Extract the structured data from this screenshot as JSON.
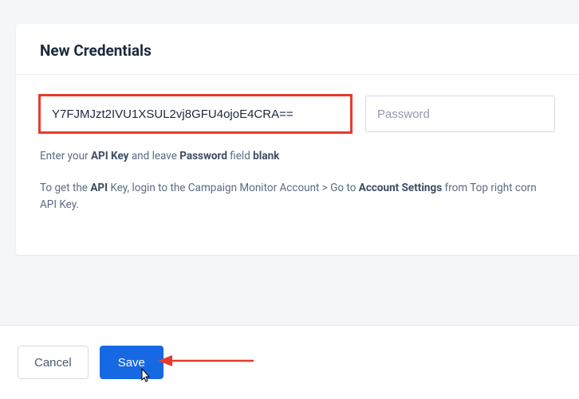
{
  "card": {
    "title": "New Credentials",
    "api_key_value": "Y7FJMJzt2IVU1XSUL2vj8GFU4ojoE4CRA==",
    "password_placeholder": "Password",
    "hint1_prefix": "Enter your ",
    "hint1_bold1": "API Key",
    "hint1_mid": " and leave ",
    "hint1_bold2": "Password",
    "hint1_suffix": " field ",
    "hint1_bold3": "blank",
    "hint2_prefix": "To get the ",
    "hint2_bold1": "API",
    "hint2_mid1": " Key, login to the Campaign Monitor Account > Go to ",
    "hint2_bold2": "Account Settings",
    "hint2_mid2": " from Top right corn",
    "hint2_line2": "API Key."
  },
  "footer": {
    "cancel_label": "Cancel",
    "save_label": "Save"
  }
}
